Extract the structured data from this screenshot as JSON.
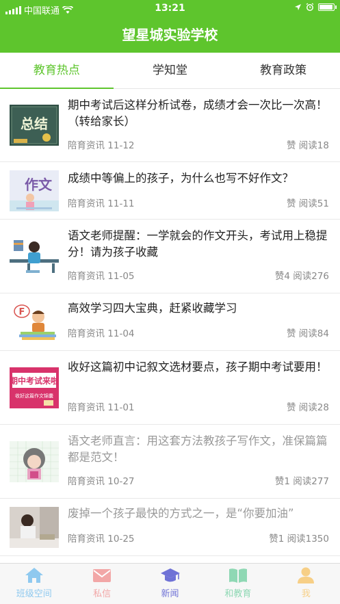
{
  "status": {
    "carrier": "中国联通",
    "time": "13:21"
  },
  "header": {
    "title": "望星城实验学校"
  },
  "tabs": [
    {
      "label": "教育热点",
      "active": true
    },
    {
      "label": "学知堂",
      "active": false
    },
    {
      "label": "教育政策",
      "active": false
    }
  ],
  "articles": [
    {
      "title": "期中考试后这样分析试卷，成绩才会一次比一次高！（转给家长）",
      "source": "陪育资讯 11-12",
      "stats": "赞  阅读18",
      "thumb_text": "总结"
    },
    {
      "title": "成绩中等偏上的孩子，为什么也写不好作文？",
      "source": "陪育资讯 11-11",
      "stats": "赞  阅读51",
      "thumb_text": "作文"
    },
    {
      "title": "语文老师提醒：一学就会的作文开头，考试用上稳提分！请为孩子收藏",
      "source": "陪育资讯 11-05",
      "stats": "赞4  阅读276",
      "thumb_text": ""
    },
    {
      "title": "高效学习四大宝典，赶紧收藏学习",
      "source": "陪育资讯 11-04",
      "stats": "赞  阅读84",
      "thumb_text": "F"
    },
    {
      "title": "收好这篇初中记叙文选材要点，孩子期中考试要用！",
      "source": "陪育资讯 11-01",
      "stats": "赞  阅读28",
      "thumb_text": "期中考试来啦",
      "thumb_subtext": "收好这篇作文锦囊"
    },
    {
      "title": "语文老师直言：用这套方法教孩子写作文，准保篇篇都是范文！",
      "source": "陪育资讯 10-27",
      "stats": "赞1  阅读277",
      "thumb_text": ""
    },
    {
      "title": "废掉一个孩子最快的方式之一，是“你要加油”",
      "source": "陪育资讯 10-25",
      "stats": "赞1  阅读1350",
      "thumb_text": ""
    }
  ],
  "bottom_nav": [
    {
      "label": "班级空间",
      "icon": "home-icon",
      "color": "#8fc9ef"
    },
    {
      "label": "私信",
      "icon": "mail-icon",
      "color": "#f2a7a7"
    },
    {
      "label": "新闻",
      "icon": "graduation-cap-icon",
      "color": "#6f72d6"
    },
    {
      "label": "和教育",
      "icon": "book-icon",
      "color": "#8fd8b4"
    },
    {
      "label": "我",
      "icon": "user-icon",
      "color": "#f7cf86"
    }
  ],
  "colors": {
    "brand": "#5ec52d",
    "active_nav": "#6f72d6"
  }
}
